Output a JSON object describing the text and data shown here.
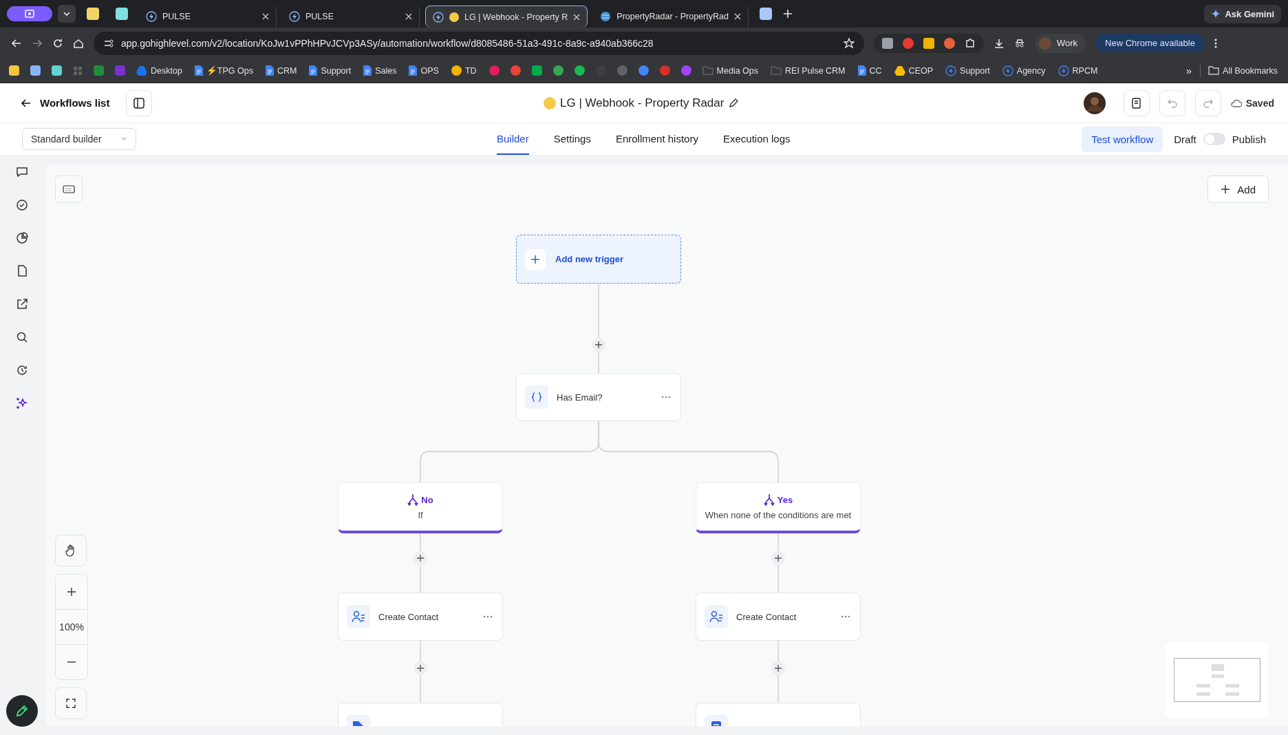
{
  "browser": {
    "tabs": [
      {
        "title": "PULSE",
        "selected": false,
        "kind": "bolt"
      },
      {
        "title": "PULSE",
        "selected": false,
        "kind": "bolt"
      },
      {
        "title": "LG | Webhook - Property R",
        "selected": true,
        "kind": "bolt"
      },
      {
        "title": "PropertyRadar - PropertyRad",
        "selected": false,
        "kind": "globe"
      }
    ],
    "ask_gemini": "Ask Gemini",
    "address": "app.gohighlevel.com/v2/location/KoJw1vPPhHPvJCVp3ASy/automation/workflow/d8085486-51a3-491c-8a9c-a940ab366c28",
    "profile": "Work",
    "update": "New Chrome available",
    "bookmarks": [
      {
        "kind": "square",
        "color": "#f5c542"
      },
      {
        "kind": "square",
        "color": "#8ab4f8"
      },
      {
        "kind": "square",
        "color": "#5fd4d0"
      },
      {
        "kind": "grid",
        "color": "#5f6368"
      },
      {
        "kind": "square",
        "color": "#1e8e3e"
      },
      {
        "kind": "square",
        "color": "#7b2fd1"
      },
      {
        "kind": "drive",
        "color": "#1a73e8",
        "label": "Desktop"
      },
      {
        "kind": "doc",
        "color": "#4285f4",
        "label": "⚡TPG Ops"
      },
      {
        "kind": "doc",
        "color": "#4285f4",
        "label": "CRM"
      },
      {
        "kind": "doc",
        "color": "#4285f4",
        "label": "Support"
      },
      {
        "kind": "doc",
        "color": "#4285f4",
        "label": "Sales"
      },
      {
        "kind": "doc",
        "color": "#4285f4",
        "label": "OPS"
      },
      {
        "kind": "dot",
        "color": "#f4b400",
        "label": "TD"
      },
      {
        "kind": "dot",
        "color": "#e01e5a"
      },
      {
        "kind": "dot",
        "color": "#ea4335"
      },
      {
        "kind": "square",
        "color": "#00ac47"
      },
      {
        "kind": "dot",
        "color": "#34a853"
      },
      {
        "kind": "dot",
        "color": "#1db954"
      },
      {
        "kind": "dot",
        "color": "#3c4043"
      },
      {
        "kind": "dot",
        "color": "#5f6368"
      },
      {
        "kind": "dot",
        "color": "#4285f4"
      },
      {
        "kind": "dot",
        "color": "#d93025"
      },
      {
        "kind": "dot",
        "color": "#a142f4"
      },
      {
        "kind": "folder",
        "color": "#5f6368",
        "label": "Media Ops"
      },
      {
        "kind": "folder",
        "color": "#5f6368",
        "label": "REI Pulse CRM"
      },
      {
        "kind": "doc",
        "color": "#4285f4",
        "label": "CC"
      },
      {
        "kind": "drive",
        "color": "#fbbc04",
        "label": "CEOP"
      },
      {
        "kind": "bolt",
        "color": "#4285f4",
        "label": "Support"
      },
      {
        "kind": "bolt",
        "color": "#4285f4",
        "label": "Agency"
      },
      {
        "kind": "bolt",
        "color": "#4285f4",
        "label": "RPCM"
      }
    ],
    "more": "»",
    "all_bookmarks": "All Bookmarks"
  },
  "header": {
    "back": "Workflows list",
    "title": "LG | Webhook - Property Radar",
    "status": "Saved"
  },
  "toolbar": {
    "builder": "Standard builder",
    "tabs": [
      {
        "label": "Builder",
        "selected": true
      },
      {
        "label": "Settings",
        "selected": false
      },
      {
        "label": "Enrollment history",
        "selected": false
      },
      {
        "label": "Execution logs",
        "selected": false
      }
    ],
    "test": "Test workflow",
    "draft": "Draft",
    "publish_on": false,
    "publish": "Publish"
  },
  "sidebar_items": [
    {
      "selected": false
    },
    {
      "selected": false
    },
    {
      "selected": false
    },
    {
      "selected": false
    },
    {
      "selected": false
    },
    {
      "selected": false
    },
    {
      "selected": false
    },
    {
      "selected": true
    }
  ],
  "canvas": {
    "add": "Add",
    "trigger": "Add new trigger",
    "condition": "Has Email?",
    "zoom": "100%",
    "branches": [
      {
        "label": "No",
        "condition": "If",
        "steps": [
          {
            "kind": "contact",
            "label": "Create Contact"
          },
          {
            "kind": "tag"
          }
        ]
      },
      {
        "label": "Yes",
        "condition": "When none of the conditions are met",
        "steps": [
          {
            "kind": "contact",
            "label": "Create Contact"
          },
          {
            "kind": "note"
          }
        ]
      }
    ]
  }
}
